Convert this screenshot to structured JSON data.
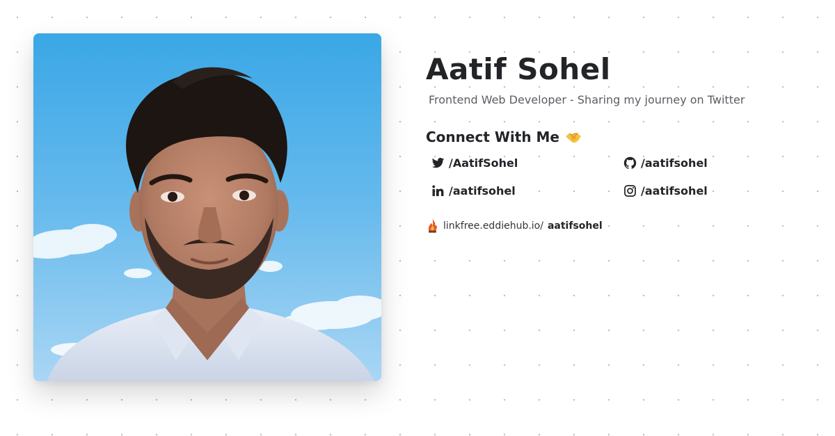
{
  "profile": {
    "name": "Aatif Sohel",
    "tagline": "Frontend Web Developer - Sharing my journey on Twitter",
    "photo_icon": "profile-photo"
  },
  "connect": {
    "heading": "Connect With Me",
    "emoji_icon": "handshake-icon"
  },
  "socials": [
    {
      "icon": "twitter-icon",
      "label": "/AatifSohel"
    },
    {
      "icon": "github-icon",
      "label": "/aatifsohel"
    },
    {
      "icon": "linkedin-icon",
      "label": "/aatifsohel"
    },
    {
      "icon": "instagram-icon",
      "label": "/aatifsohel"
    }
  ],
  "linkfree": {
    "icon": "linkfree-icon",
    "prefix": "linkfree.eddiehub.io/",
    "handle": "aatifsohel"
  },
  "colors": {
    "background": "#ffffff",
    "dot": "#b9bcc2",
    "text": "#222428",
    "muted": "#5a5d63",
    "sky": "#3aa8e6"
  }
}
